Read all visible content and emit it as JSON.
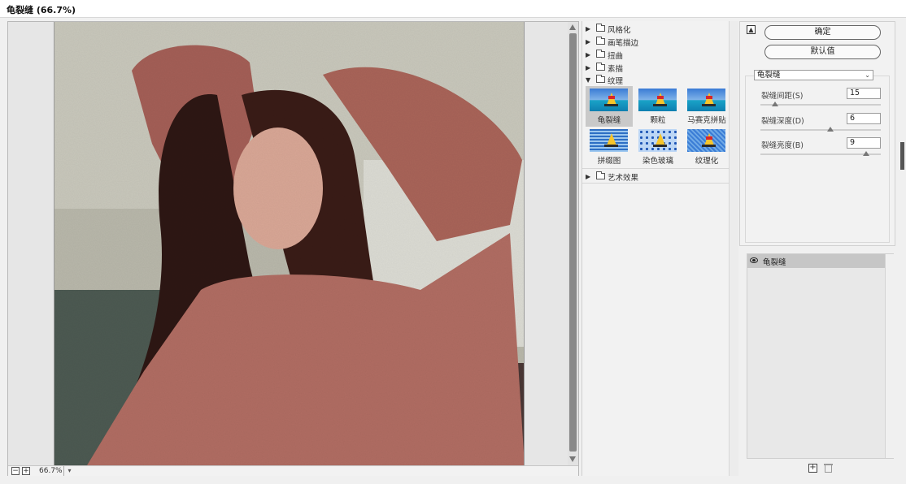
{
  "window": {
    "title": "龟裂缝 (66.7%)"
  },
  "preview": {
    "zoom_label": "66.7%",
    "zoom_out_label": "−",
    "zoom_in_label": "+",
    "zoom_dropdown": "▾"
  },
  "gallery": {
    "categories": [
      {
        "label": "风格化",
        "expanded": false
      },
      {
        "label": "画笔描边",
        "expanded": false
      },
      {
        "label": "扭曲",
        "expanded": false
      },
      {
        "label": "素描",
        "expanded": false
      },
      {
        "label": "纹理",
        "expanded": true
      },
      {
        "label": "艺术效果",
        "expanded": false
      }
    ],
    "texture_filters": [
      {
        "label": "龟裂缝",
        "selected": true,
        "style": "sail"
      },
      {
        "label": "颗粒",
        "selected": false,
        "style": "sail"
      },
      {
        "label": "马赛克拼贴",
        "selected": false,
        "style": "sail"
      },
      {
        "label": "拼缀图",
        "selected": false,
        "style": "lines"
      },
      {
        "label": "染色玻璃",
        "selected": false,
        "style": "glass"
      },
      {
        "label": "纹理化",
        "selected": false,
        "style": "texture"
      }
    ]
  },
  "settings": {
    "ok_label": "确定",
    "default_label": "默认值",
    "filter_select": "龟裂缝",
    "params": [
      {
        "label": "裂缝间距(S)",
        "value": "15",
        "fraction": 0.12
      },
      {
        "label": "裂缝深度(D)",
        "value": "6",
        "fraction": 0.58
      },
      {
        "label": "裂缝亮度(B)",
        "value": "9",
        "fraction": 0.88
      }
    ]
  },
  "layers": {
    "items": [
      {
        "label": "龟裂缝",
        "visible": true
      }
    ]
  },
  "colors": {
    "selected_bg": "#c9c9c9",
    "panel_bg": "#f2f2f2",
    "accent_sky": "#3a7bd5",
    "sail": "#f7c52b"
  }
}
